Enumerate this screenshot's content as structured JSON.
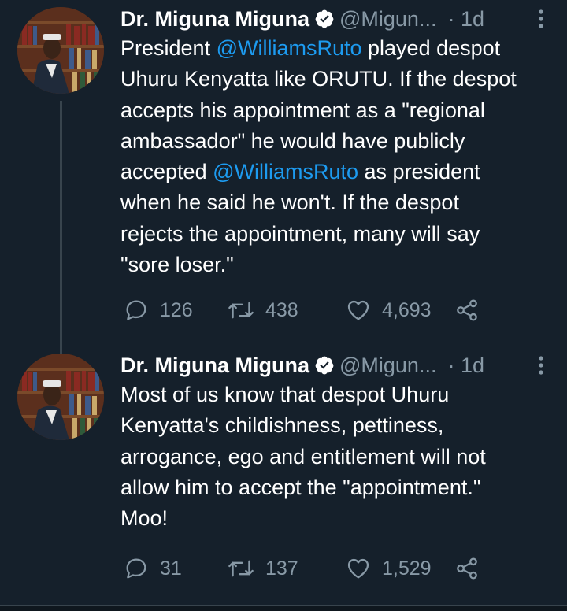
{
  "tweets": [
    {
      "author_name": "Dr. Miguna Miguna",
      "handle": "@Migun...",
      "time": "· 1d",
      "text_parts": [
        {
          "text": "President ",
          "mention": false
        },
        {
          "text": "@WilliamsRuto",
          "mention": true
        },
        {
          "text": " played despot\nUhuru Kenyatta like ORUTU. If the despot\naccepts his appointment as a \"regional\nambassador\" he would have publicly\naccepted ",
          "mention": false
        },
        {
          "text": "@WilliamsRuto",
          "mention": true
        },
        {
          "text": " as president\nwhen he said he won't. If the despot\nrejects the appointment, many will say\n\"sore loser.\"",
          "mention": false
        }
      ],
      "replies": "126",
      "retweets": "438",
      "likes": "4,693"
    },
    {
      "author_name": "Dr. Miguna Miguna",
      "handle": "@Migun...",
      "time": "· 1d",
      "text_parts": [
        {
          "text": "Most of us know that despot Uhuru\nKenyatta's childishness, pettiness,\narrogance, ego and entitlement will not\nallow him to accept the \"appointment.\"\nMoo!",
          "mention": false
        }
      ],
      "replies": "31",
      "retweets": "137",
      "likes": "1,529"
    }
  ],
  "icons": {
    "reply": "speech-bubble-icon",
    "retweet": "retweet-arrows-icon",
    "like": "heart-outline-icon",
    "share": "share-nodes-icon",
    "verified": "verified-badge-icon",
    "more": "vertical-dots-icon"
  },
  "colors": {
    "background": "#15202b",
    "text": "#ffffff",
    "secondary": "#8899a6",
    "mention": "#1d9bf0",
    "thread_line": "#38444d"
  }
}
